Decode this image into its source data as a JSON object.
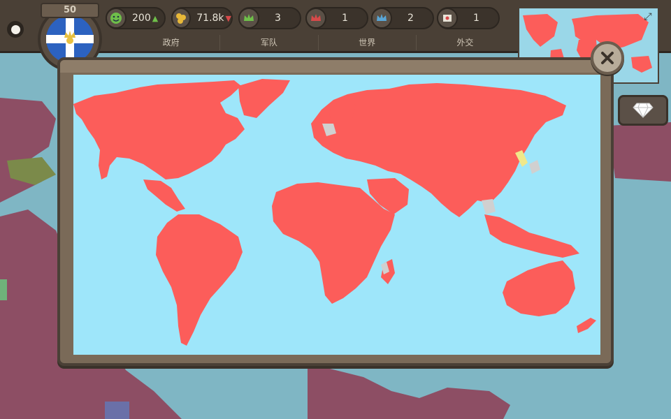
{
  "player": {
    "level": "50"
  },
  "resources": [
    {
      "icon": "happiness-icon",
      "value": "200",
      "trend": "up",
      "color": "#6fbf4a"
    },
    {
      "icon": "coins-icon",
      "value": "71.8k",
      "trend": "down",
      "color": "#e8b838"
    },
    {
      "icon": "green-crown-icon",
      "value": "3",
      "color": "#6fbf4a"
    },
    {
      "icon": "red-crown-icon",
      "value": "1",
      "color": "#d64a4a"
    },
    {
      "icon": "blue-crown-icon",
      "value": "2",
      "color": "#5aa6d6"
    },
    {
      "icon": "treaty-icon",
      "value": "1",
      "color": "#e9e4d8"
    }
  ],
  "tabs": [
    "政府",
    "军队",
    "世界",
    "外交"
  ],
  "colors": {
    "land": "#fc5d5a",
    "ocean": "#9ee6fa",
    "neutral": "#d0d0d0",
    "highlight": "#f0e88a",
    "frame": "#7a6a58"
  }
}
